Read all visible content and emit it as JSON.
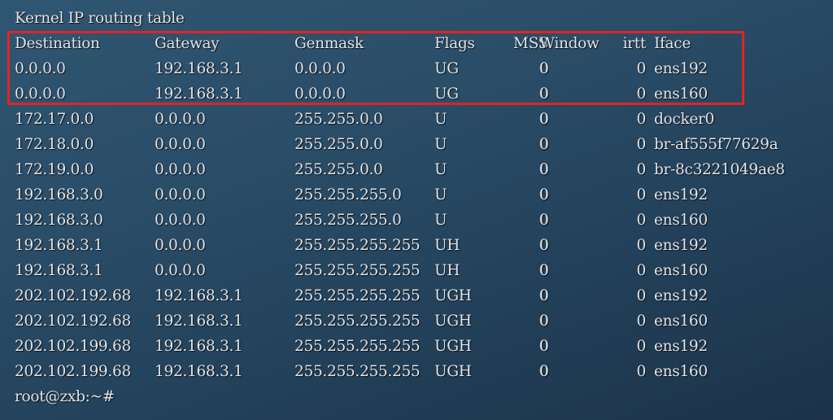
{
  "terminal": {
    "title_line": "Kernel IP routing table",
    "columns": {
      "destination": "Destination",
      "gateway": "Gateway",
      "genmask": "Genmask",
      "flags": "Flags",
      "mss": "MSS",
      "window": "Window",
      "irtt": "irtt",
      "iface": "Iface"
    },
    "rows": [
      {
        "destination": "0.0.0.0",
        "gateway": "192.168.3.1",
        "genmask": "0.0.0.0",
        "flags": "UG",
        "mss": "0",
        "window": "0",
        "irtt": "0",
        "iface": "ens192"
      },
      {
        "destination": "0.0.0.0",
        "gateway": "192.168.3.1",
        "genmask": "0.0.0.0",
        "flags": "UG",
        "mss": "0",
        "window": "0",
        "irtt": "0",
        "iface": "ens160"
      },
      {
        "destination": "172.17.0.0",
        "gateway": "0.0.0.0",
        "genmask": "255.255.0.0",
        "flags": "U",
        "mss": "0",
        "window": "0",
        "irtt": "0",
        "iface": "docker0"
      },
      {
        "destination": "172.18.0.0",
        "gateway": "0.0.0.0",
        "genmask": "255.255.0.0",
        "flags": "U",
        "mss": "0",
        "window": "0",
        "irtt": "0",
        "iface": "br-af555f77629a"
      },
      {
        "destination": "172.19.0.0",
        "gateway": "0.0.0.0",
        "genmask": "255.255.0.0",
        "flags": "U",
        "mss": "0",
        "window": "0",
        "irtt": "0",
        "iface": "br-8c3221049ae8"
      },
      {
        "destination": "192.168.3.0",
        "gateway": "0.0.0.0",
        "genmask": "255.255.255.0",
        "flags": "U",
        "mss": "0",
        "window": "0",
        "irtt": "0",
        "iface": "ens192"
      },
      {
        "destination": "192.168.3.0",
        "gateway": "0.0.0.0",
        "genmask": "255.255.255.0",
        "flags": "U",
        "mss": "0",
        "window": "0",
        "irtt": "0",
        "iface": "ens160"
      },
      {
        "destination": "192.168.3.1",
        "gateway": "0.0.0.0",
        "genmask": "255.255.255.255",
        "flags": "UH",
        "mss": "0",
        "window": "0",
        "irtt": "0",
        "iface": "ens192"
      },
      {
        "destination": "192.168.3.1",
        "gateway": "0.0.0.0",
        "genmask": "255.255.255.255",
        "flags": "UH",
        "mss": "0",
        "window": "0",
        "irtt": "0",
        "iface": "ens160"
      },
      {
        "destination": "202.102.192.68",
        "gateway": "192.168.3.1",
        "genmask": "255.255.255.255",
        "flags": "UGH",
        "mss": "0",
        "window": "0",
        "irtt": "0",
        "iface": "ens192"
      },
      {
        "destination": "202.102.192.68",
        "gateway": "192.168.3.1",
        "genmask": "255.255.255.255",
        "flags": "UGH",
        "mss": "0",
        "window": "0",
        "irtt": "0",
        "iface": "ens160"
      },
      {
        "destination": "202.102.199.68",
        "gateway": "192.168.3.1",
        "genmask": "255.255.255.255",
        "flags": "UGH",
        "mss": "0",
        "window": "0",
        "irtt": "0",
        "iface": "ens192"
      },
      {
        "destination": "202.102.199.68",
        "gateway": "192.168.3.1",
        "genmask": "255.255.255.255",
        "flags": "UGH",
        "mss": "0",
        "window": "0",
        "irtt": "0",
        "iface": "ens160"
      }
    ],
    "prompt": "root@zxb:~#",
    "highlight_color": "#e02424"
  }
}
